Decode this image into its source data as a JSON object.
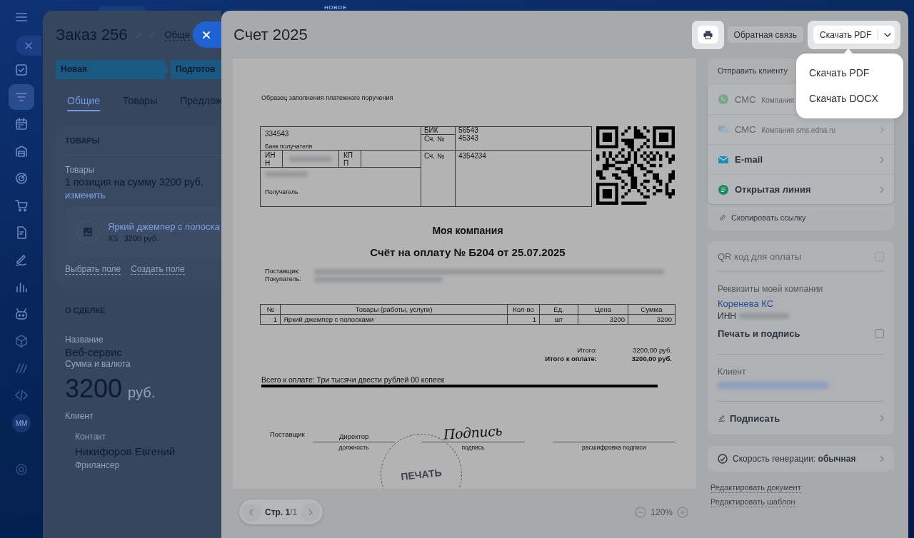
{
  "top_badge": "НОВОЕ",
  "sidebar": {
    "items": [
      {
        "selected": false
      },
      {
        "selected": true
      },
      {
        "selected": false
      },
      {
        "selected": false
      },
      {
        "selected": false
      },
      {
        "selected": false
      },
      {
        "selected": false
      },
      {
        "selected": false
      },
      {
        "selected": false
      },
      {
        "selected": false
      },
      {
        "selected": false
      },
      {
        "selected": false
      },
      {
        "selected": false
      }
    ],
    "avatar": "MM"
  },
  "order_panel": {
    "title": "Заказ 256",
    "view_label": "Обще",
    "stages": [
      {
        "label": "Новая"
      },
      {
        "label": "Подготов"
      }
    ],
    "tabs": [
      {
        "label": "Общие",
        "selected": true
      },
      {
        "label": "Товары",
        "selected": false
      },
      {
        "label": "Предлож",
        "selected": false
      }
    ],
    "goods_section": {
      "heading": "ТОВАРЫ",
      "field_label": "Товары",
      "summary": "1 позиция на сумму 3200 руб.",
      "change_link": "изменить",
      "product": {
        "name": "Яркий джемпер с полоска",
        "size": "XS",
        "price": "3200 руб."
      },
      "field_links": [
        "Выбрать поле",
        "Создать поле"
      ]
    },
    "deal_section": {
      "heading": "О СДЕЛКЕ",
      "name_label": "Название",
      "name": "Веб-сервис",
      "amount_label": "Сумма и валюта",
      "amount": "3200",
      "currency": "руб.",
      "client_label": "Клиент",
      "contact_label": "Контакт",
      "contact_name": "Никифоров Евгений",
      "contact_role": "Фрилансер"
    }
  },
  "invoice_modal": {
    "title": "Счет 2025",
    "feedback_button": "Обратная связь",
    "download_button": "Скачать PDF",
    "download_menu": [
      "Скачать PDF",
      "Скачать DOCX"
    ],
    "document": {
      "caption": "Образец заполнения платежного поручения",
      "bank": {
        "bank_account": "334543",
        "bank_label": "Банк получателя",
        "inn_label": "ИНН",
        "kpp_label": "КПП",
        "recipient_label": "Получатель",
        "bik_label": "БИК",
        "bik": "56543",
        "corr_label": "Сч. №",
        "corr": "45343",
        "account_label": "Сч. №",
        "account": "4354234"
      },
      "company": "Моя компания",
      "heading": "Счёт на оплату № Б204 от 25.07.2025",
      "parties": [
        "Поставщик:",
        "Покупатель:"
      ],
      "items": {
        "columns": [
          "№",
          "Товары (работы, услуги)",
          "Кол-во",
          "Ед.",
          "Цена",
          "Сумма"
        ],
        "rows": [
          [
            "1",
            "Яркий джемпер с полосками",
            "1",
            "шт",
            "3200",
            "3200"
          ]
        ]
      },
      "totals": [
        {
          "label": "Итого:",
          "value": "3200,00 руб.",
          "bold": false
        },
        {
          "label": "Итого к оплате:",
          "value": "3200,00 руб.",
          "bold": true
        }
      ],
      "amount_words": "Всего к оплате: Три тысячи двести рублей 00 копеек",
      "signature": {
        "party": "Поставщик",
        "position": "Директор",
        "position_caption": "должность",
        "handwriting": "Подпись",
        "sign_caption": "подпись",
        "name_caption": "расшифровка подписи"
      },
      "stamp": "ПЕЧАТЬ"
    },
    "pager": "**Стр. 1**/1",
    "zoom": "120%"
  },
  "send_panel": {
    "heading": "Отправить клиенту",
    "channels": [
      {
        "kind": "whatsapp",
        "name": "СМС",
        "provider": "Компания",
        "disabled": true
      },
      {
        "kind": "chat",
        "name": "СМС",
        "provider": "Компания sms.edna.ru",
        "disabled": true
      },
      {
        "kind": "mail",
        "name": "E-mail",
        "disabled": false
      },
      {
        "kind": "openline",
        "name": "Открытая линия",
        "disabled": false
      }
    ],
    "copy_link": "Скопировать ссылку"
  },
  "settings": {
    "qr": {
      "label": "QR код для оплаты",
      "checked": false,
      "disabled": true
    },
    "company_label": "Реквизиты моей компании",
    "company_name": "Коренева КС",
    "inn_label": "ИНН",
    "stamp_sign": {
      "label": "Печать и подпись",
      "checked": false
    },
    "client_label": "Клиент",
    "sign_action": "Подписать"
  },
  "generation_speed": "Скорость генерации: **обычная**",
  "edit_links": [
    "Редактировать документ",
    "Редактировать шаблон"
  ]
}
